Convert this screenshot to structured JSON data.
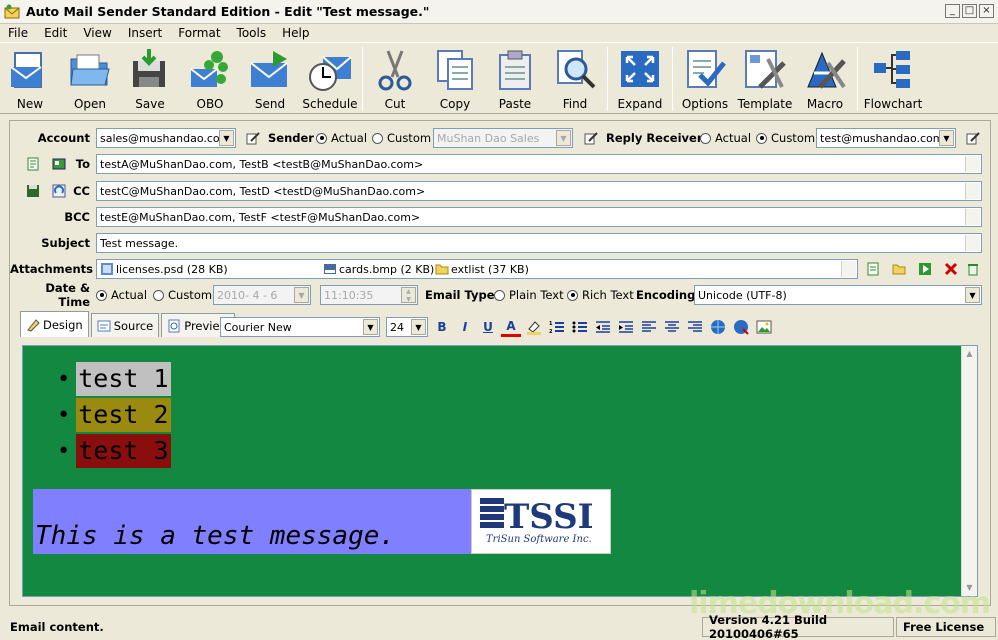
{
  "window": {
    "title": "Auto Mail Sender Standard Edition - Edit \"Test message.\""
  },
  "menu": [
    "File",
    "Edit",
    "View",
    "Insert",
    "Format",
    "Tools",
    "Help"
  ],
  "toolbar": [
    "New",
    "Open",
    "Save",
    "OBO",
    "Send",
    "Schedule",
    "Cut",
    "Copy",
    "Paste",
    "Find",
    "Expand",
    "Options",
    "Template",
    "Macro",
    "Flowchart"
  ],
  "form": {
    "account_label": "Account",
    "account_value": "sales@mushandao.com",
    "sender_label": "Sender",
    "sender_actual": "Actual",
    "sender_custom": "Custom",
    "sender_custom_value": "MuShan Dao Sales",
    "reply_label": "Reply Receiver",
    "reply_actual": "Actual",
    "reply_custom": "Custom",
    "reply_value": "test@mushandao.com",
    "to_label": "To",
    "to_value": "testA@MuShanDao.com, TestB <testB@MuShanDao.com>",
    "cc_label": "CC",
    "cc_value": "testC@MuShanDao.com, TestD <testD@MuShanDao.com>",
    "bcc_label": "BCC",
    "bcc_value": "testE@MuShanDao.com, TestF <testF@MuShanDao.com>",
    "subject_label": "Subject",
    "subject_value": "Test message.",
    "attach_label": "Attachments",
    "attachments": [
      "licenses.psd (28 KB)",
      "cards.bmp (2 KB)",
      "extlist (37 KB)"
    ],
    "datetime_label": "Date & Time",
    "dt_actual": "Actual",
    "dt_custom": "Custom",
    "date_value": "2010- 4 - 6",
    "time_value": "11:10:35",
    "emailtype_label": "Email Type",
    "plain_text": "Plain Text",
    "rich_text": "Rich Text",
    "encoding_label": "Encoding",
    "encoding_value": "Unicode (UTF-8)"
  },
  "editor": {
    "tabs": [
      "Design",
      "Source",
      "Preview"
    ],
    "font": "Courier New",
    "size": "24",
    "bullets": [
      "test 1",
      "test 2",
      "test 3"
    ],
    "message": "This is a test message.",
    "logo_big": "TSSI",
    "logo_small": "TriSun Software Inc."
  },
  "status": {
    "left": "Email content.",
    "version": "Version 4.21 Build 20100406#65",
    "license": "Free License"
  },
  "watermark": "limedownload.com"
}
